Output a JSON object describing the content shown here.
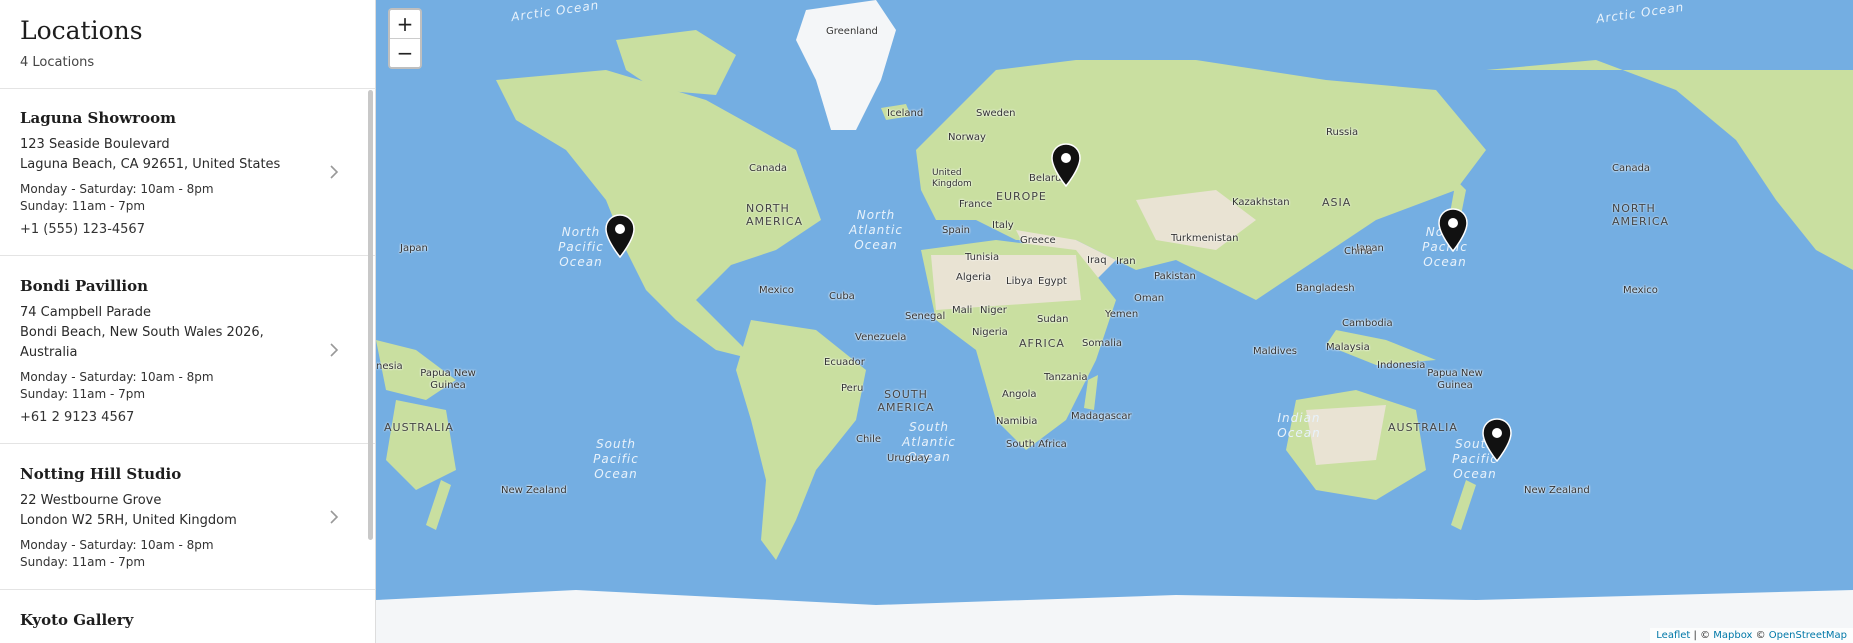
{
  "sidebar": {
    "title": "Locations",
    "count": "4 Locations",
    "locations": [
      {
        "name": "Laguna Showroom",
        "address1": "123 Seaside Boulevard",
        "address2": "Laguna Beach, CA 92651, United States",
        "address3": "",
        "hours1": "Monday - Saturday: 10am - 8pm",
        "hours2": "Sunday: 11am - 7pm",
        "phone": "+1 (555) 123-4567"
      },
      {
        "name": "Bondi Pavillion",
        "address1": "74 Campbell Parade",
        "address2": "Bondi Beach, New South Wales 2026,",
        "address3": "Australia",
        "hours1": "Monday - Saturday: 10am - 8pm",
        "hours2": "Sunday: 11am - 7pm",
        "phone": "+61 2 9123 4567"
      },
      {
        "name": "Notting Hill Studio",
        "address1": "22 Westbourne Grove",
        "address2": "London W2 5RH, United Kingdom",
        "address3": "",
        "hours1": "Monday - Saturday: 10am - 8pm",
        "hours2": "Sunday: 11am - 7pm",
        "phone": ""
      },
      {
        "name": "Kyoto Gallery"
      }
    ]
  },
  "map": {
    "zoom_in": "+",
    "zoom_out": "−",
    "attribution": {
      "leaflet": "Leaflet",
      "sep1": " | © ",
      "mapbox": "Mapbox",
      "sep2": " © ",
      "osm": "OpenStreetMap"
    },
    "labels": {
      "greenland": "Greenland",
      "iceland": "Iceland",
      "sweden": "Sweden",
      "norway": "Norway",
      "russia": "Russia",
      "canada": "Canada",
      "canada2": "Canada",
      "united_kingdom": "United Kingdom",
      "belarus": "Belarus",
      "europe": "EUROPE",
      "france": "France",
      "kazakhstan": "Kazakhstan",
      "asia": "ASIA",
      "north_america": "NORTH AMERICA",
      "north_america2": "NORTH AMERICA",
      "spain": "Spain",
      "italy": "Italy",
      "greece": "Greece",
      "turkmenistan": "Turkmenistan",
      "japan": "Japan",
      "japan2": "Japan",
      "china": "China",
      "tunisia": "Tunisia",
      "iraq": "Iraq",
      "iran": "Iran",
      "algeria": "Algeria",
      "libya": "Libya",
      "egypt": "Egypt",
      "pakistan": "Pakistan",
      "mexico": "Mexico",
      "mexico2": "Mexico",
      "cuba": "Cuba",
      "bangladesh": "Bangladesh",
      "oman": "Oman",
      "senegal": "Senegal",
      "mali": "Mali",
      "niger": "Niger",
      "sudan": "Sudan",
      "yemen": "Yemen",
      "venezuela": "Venezuela",
      "nigeria": "Nigeria",
      "cambodia": "Cambodia",
      "africa": "AFRICA",
      "somalia": "Somalia",
      "maldives": "Maldives",
      "malaysia": "Malaysia",
      "ecuador": "Ecuador",
      "indonesia": "Indonesia",
      "nesia": "nesia",
      "papua1": "Papua New Guinea",
      "papua2": "Papua New Guinea",
      "peru": "Peru",
      "south_america": "SOUTH AMERICA",
      "tanzania": "Tanzania",
      "angola": "Angola",
      "madagascar": "Madagascar",
      "namibia": "Namibia",
      "australia": "AUSTRALIA",
      "australia2": "AUSTRALIA",
      "chile": "Chile",
      "south_africa": "South Africa",
      "uruguay": "Uruguay",
      "new_zealand": "New Zealand",
      "new_zealand2": "New Zealand"
    },
    "oceans": {
      "arctic": "Arctic Ocean",
      "arctic2": "Arctic Ocean",
      "north_pacific": "North Pacific Ocean",
      "north_pacific2": "North Pacific Ocean",
      "north_atlantic": "North Atlantic Ocean",
      "south_atlantic": "South Atlantic Ocean",
      "south_pacific": "South Pacific Ocean",
      "south_pacific2": "South Pacific Ocean",
      "indian": "Indian Ocean"
    },
    "colors": {
      "water": "#74aee2",
      "land": "#c9dfa0",
      "desert": "#e9e3d3",
      "ice": "#f4f6f8",
      "marker": "#111111"
    }
  }
}
